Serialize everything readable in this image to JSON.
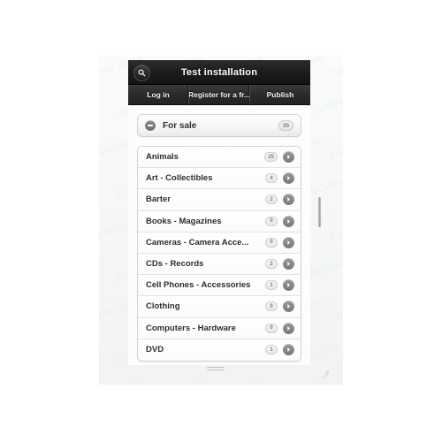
{
  "window": {
    "title": "Test installation",
    "search_icon": "search-icon"
  },
  "tabs": [
    {
      "label": "Log in"
    },
    {
      "label": "Register for a fr..."
    },
    {
      "label": "Publish"
    }
  ],
  "section": {
    "title": "For sale",
    "count": "35",
    "collapse_icon": "minus-circle-icon"
  },
  "categories": [
    {
      "label": "Animals",
      "count": "25"
    },
    {
      "label": "Art - Collectibles",
      "count": "4"
    },
    {
      "label": "Barter",
      "count": "2"
    },
    {
      "label": "Books - Magazines",
      "count": "0"
    },
    {
      "label": "Cameras - Camera Acce...",
      "count": "0"
    },
    {
      "label": "CDs - Records",
      "count": "2"
    },
    {
      "label": "Cell Phones - Accessories",
      "count": "1"
    },
    {
      "label": "Clothing",
      "count": "0"
    },
    {
      "label": "Computers - Hardware",
      "count": "0"
    },
    {
      "label": "DVD",
      "count": "1"
    }
  ],
  "colors": {
    "titlebar": "#1d1d1d",
    "tabbar": "#2b2b2b",
    "panel": "#f7f8f8",
    "card": "#ffffff",
    "accent": "#777777",
    "text": "#2c2c2c"
  },
  "watermark": {
    "text": "CodeCanyon"
  }
}
